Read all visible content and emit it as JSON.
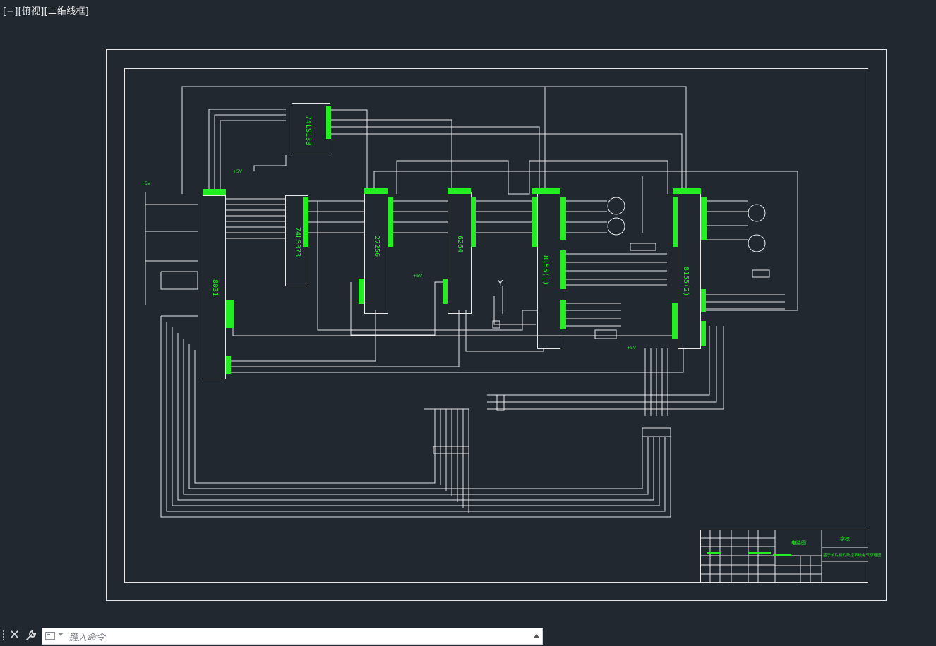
{
  "viewport": {
    "label": "[−][俯视][二维线框]"
  },
  "colors": {
    "background": "#212830",
    "wire": "#e8e8e8",
    "accent": "#22ee22"
  },
  "schematic": {
    "chips": {
      "decoder": "74LS138",
      "cpu": "8031",
      "latch": "74LS373",
      "eprom": "27256",
      "ram": "6264",
      "io1": "8155(1)",
      "io2": "8155(2)"
    },
    "labels": {
      "vcc_top": "+5V",
      "vcc_left": "+5V",
      "vcc_right": "+5V",
      "vcc_eprom": "+5V",
      "antenna": "Y"
    }
  },
  "title_block": {
    "drawing_title": "电路图",
    "school": "学校",
    "project": "基于单片机的数控系统电气原理图"
  },
  "icons": {
    "grip": "grip-dots-icon",
    "close": "close-icon",
    "tool": "wrench-icon",
    "prompt": "command-prompt-icon"
  },
  "command": {
    "placeholder": "键入命令"
  }
}
